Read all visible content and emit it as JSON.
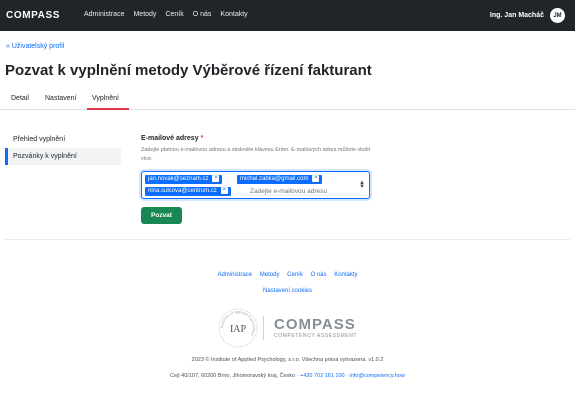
{
  "header": {
    "logo": "COMPASS",
    "nav": [
      "Administrace",
      "Metody",
      "Ceník",
      "O nás",
      "Kontakty"
    ],
    "user_name": "Ing. Jan Macháč",
    "avatar_initials": "JM"
  },
  "breadcrumb": {
    "back_label": "« Uživatelský profil"
  },
  "page": {
    "title": "Pozvat k vyplnění metody Výběrové řízení fakturant"
  },
  "tabs": [
    {
      "label": "Detail",
      "active": false
    },
    {
      "label": "Nastavení",
      "active": false
    },
    {
      "label": "Vyplnění",
      "active": true
    }
  ],
  "side_menu": [
    {
      "label": "Přehled vyplnění",
      "active": false
    },
    {
      "label": "Pozvánky k vyplnění",
      "active": true
    }
  ],
  "form": {
    "label": "E-mailové adresy",
    "required_mark": "*",
    "help": "Zadejte platnou e-mailovou adresu a stiskněte klávesu Enter. E-mailových adres můžete vložit více.",
    "tags": [
      "jan.novak@seznam.cz",
      "michal.zabka@gmail.com",
      "nina.sulcova@centrum.cz"
    ],
    "tag_remove_glyph": "×",
    "placeholder": "Zadejte e-mailovou adresu",
    "submit_label": "Pozvat",
    "colors": {
      "tag": "#0d6efd",
      "submit": "#198754"
    }
  },
  "footer": {
    "links": [
      "Administrace",
      "Metody",
      "Ceník",
      "O nás",
      "Kontakty"
    ],
    "cookies_label": "Nastavení cookies",
    "iap_text": "IAP",
    "iap_ring_text": "Institute of Applied Psychology",
    "compass_word": "COMPASS",
    "compass_sub": "COMPETENCY ASSESSMENT",
    "copyright": "2023 © Institute of Applied Psychology, s.r.o. Všechna práva vyhrazena. v1.0.2",
    "address": "Cejl 40/107, 60200 Brno, Jihomoravský kraj, Česko · ",
    "phone": "+420 702 161 100",
    "separator": " · ",
    "email": "info@competency.how"
  }
}
